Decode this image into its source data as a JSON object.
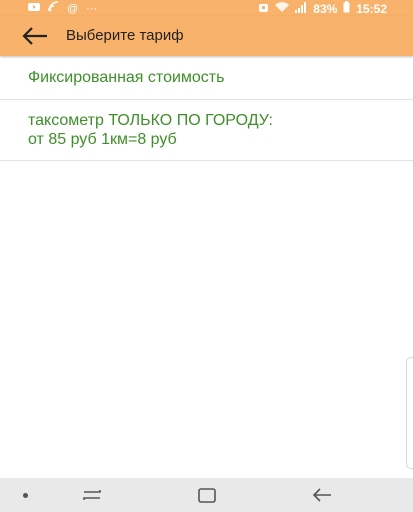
{
  "status_bar": {
    "battery": "83%",
    "time": "15:52",
    "left_icons": [
      "youtube-icon",
      "cast-icon",
      "at-icon",
      "more-dots-icon"
    ],
    "right_icons": [
      "alarm-icon",
      "wifi-icon",
      "signal-icon",
      "battery-icon"
    ]
  },
  "app_bar": {
    "title": "Выберите тариф",
    "back_icon": "arrow-left-icon",
    "color": "#f9b26b"
  },
  "tariffs": [
    {
      "line1": "Фиксированная стоимость",
      "line2": ""
    },
    {
      "line1": "таксометр ТОЛЬКО ПО ГОРОДУ:",
      "line2": "от 85 руб 1км=8 руб"
    }
  ],
  "text_color": "#3f8f2a",
  "nav_bar": {
    "buttons": [
      "recent-apps-icon",
      "home-icon",
      "back-icon"
    ]
  }
}
